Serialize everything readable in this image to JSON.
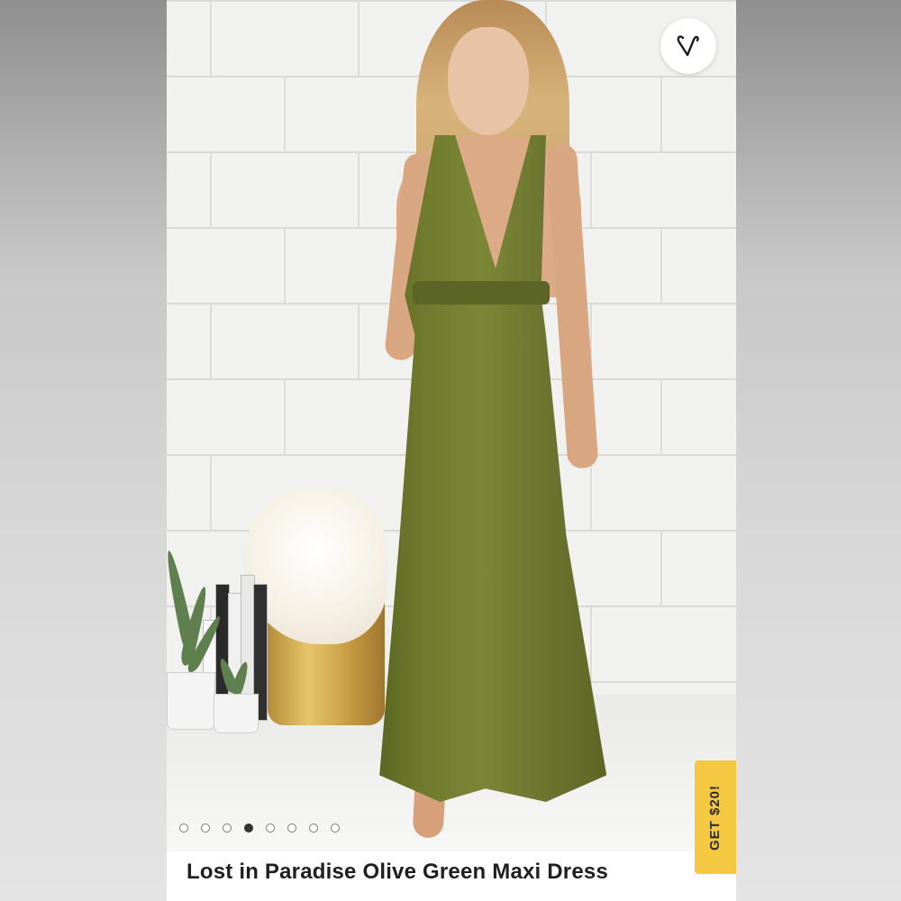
{
  "listing": {
    "title": "Lost in Paradise Olive Green Maxi Dress",
    "photo_alt": "Model wearing olive green maxi dress",
    "gallery": {
      "total_photos": 8,
      "active_index": 3
    },
    "like_icon": "heart-outline-icon"
  },
  "promo": {
    "label": "GET $20!",
    "color": "#f5c842"
  },
  "colors": {
    "dress": "#6f7a2f",
    "accent": "#f5c842"
  }
}
